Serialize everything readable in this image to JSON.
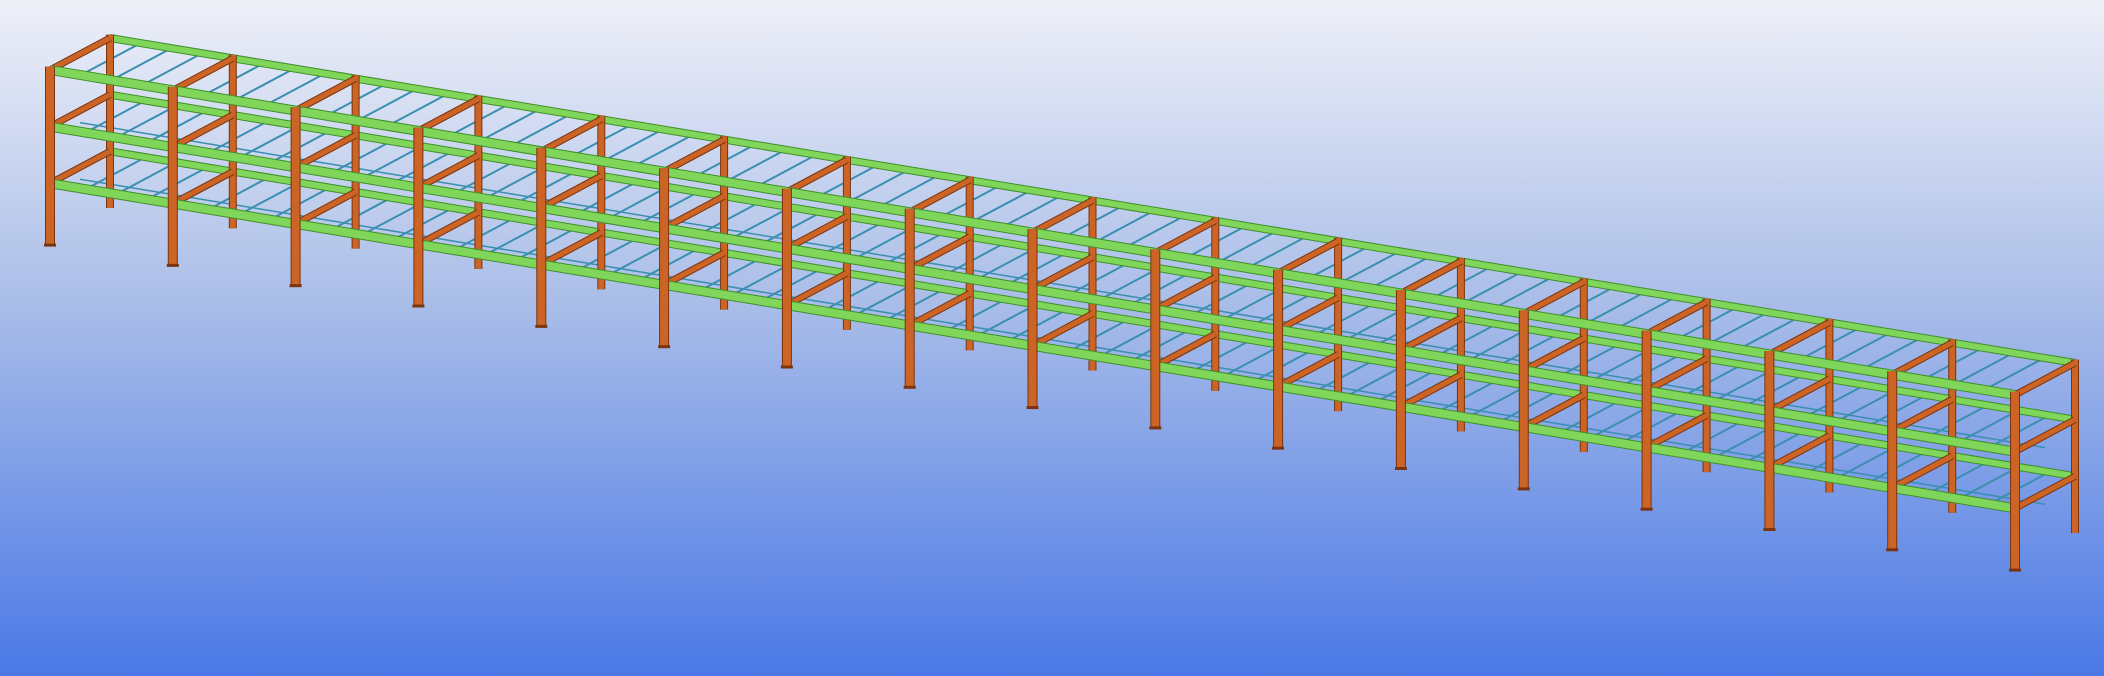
{
  "viewport": {
    "background_top": "#eef0f8",
    "background_mid": "#a9bde8",
    "background_bottom": "#4a78e6"
  },
  "model": {
    "bay_count": 16,
    "storey_count": 3,
    "column_color": "#cc6425",
    "column_edge": "#7a3410",
    "girder_color": "#7fd65a",
    "girder_edge": "#3f8f2a",
    "joist_color": "#3a8fb0"
  }
}
